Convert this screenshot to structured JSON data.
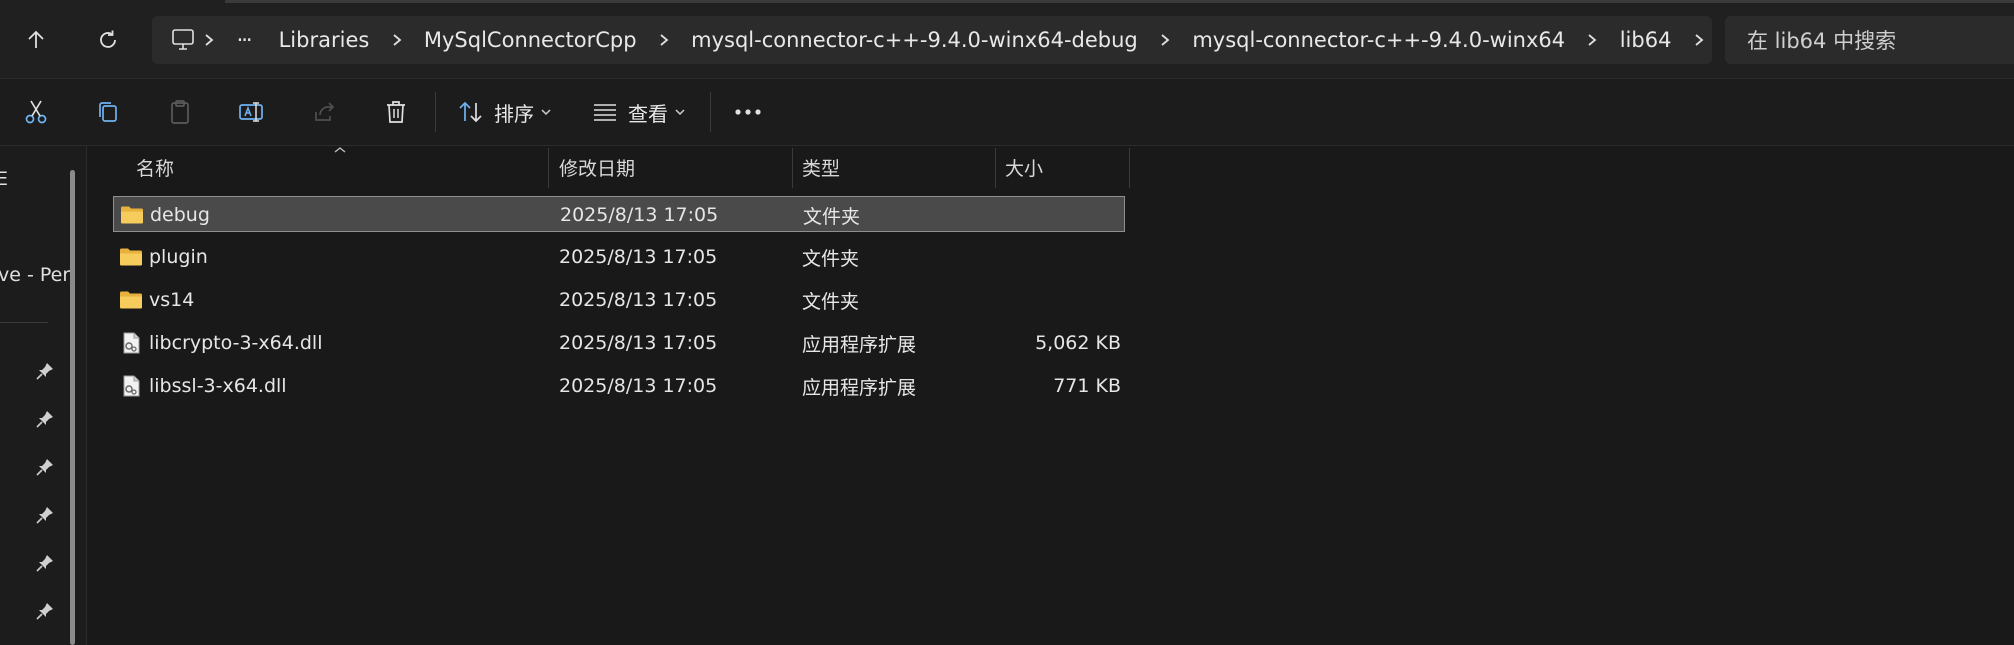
{
  "address_bar": {
    "breadcrumbs": [
      "Libraries",
      "MySqlConnectorCpp",
      "mysql-connector-c++-9.4.0-winx64-debug",
      "mysql-connector-c++-9.4.0-winx64",
      "lib64"
    ],
    "overflow_label": "···",
    "search_placeholder": "在 lib64 中搜索"
  },
  "toolbar": {
    "sort_label": "排序",
    "view_label": "查看",
    "more_label": "···"
  },
  "nav_pane": {
    "partial_label_1": "E",
    "partial_label_2": "ve - Per"
  },
  "columns": {
    "name": "名称",
    "modified": "修改日期",
    "type": "类型",
    "size": "大小"
  },
  "files": [
    {
      "name": "debug",
      "modified": "2025/8/13 17:05",
      "type": "文件夹",
      "size": "",
      "kind": "folder",
      "selected": true
    },
    {
      "name": "plugin",
      "modified": "2025/8/13 17:05",
      "type": "文件夹",
      "size": "",
      "kind": "folder",
      "selected": false
    },
    {
      "name": "vs14",
      "modified": "2025/8/13 17:05",
      "type": "文件夹",
      "size": "",
      "kind": "folder",
      "selected": false
    },
    {
      "name": "libcrypto-3-x64.dll",
      "modified": "2025/8/13 17:05",
      "type": "应用程序扩展",
      "size": "5,062 KB",
      "kind": "dll",
      "selected": false
    },
    {
      "name": "libssl-3-x64.dll",
      "modified": "2025/8/13 17:05",
      "type": "应用程序扩展",
      "size": "771 KB",
      "kind": "dll",
      "selected": false
    }
  ],
  "colors": {
    "folder": "#f0c24a",
    "accent": "#5aa0e0"
  }
}
